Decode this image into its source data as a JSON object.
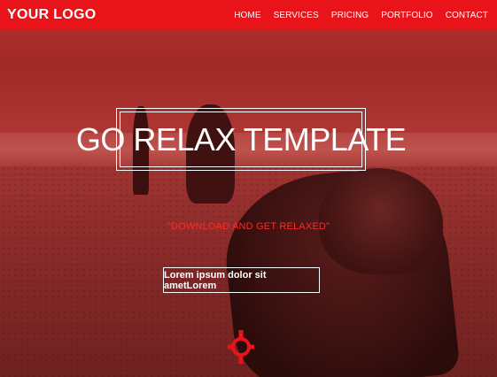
{
  "header": {
    "logo": "YOUR LOGO",
    "nav": [
      {
        "label": "HOME"
      },
      {
        "label": "SERVICES"
      },
      {
        "label": "PRICING"
      },
      {
        "label": "PORTFOLIO"
      },
      {
        "label": "CONTACT"
      }
    ]
  },
  "hero": {
    "title": "GO RELAX TEMPLATE",
    "tagline": "\"DOWNLOAD AND GET RELAXED\"",
    "cta_label": "Lorem ipsum dolor sit ametLorem",
    "scroll_icon": "crosshair-icon"
  },
  "colors": {
    "accent": "#e8141a",
    "overlay_red": "#a02a28",
    "text": "#ffffff"
  }
}
